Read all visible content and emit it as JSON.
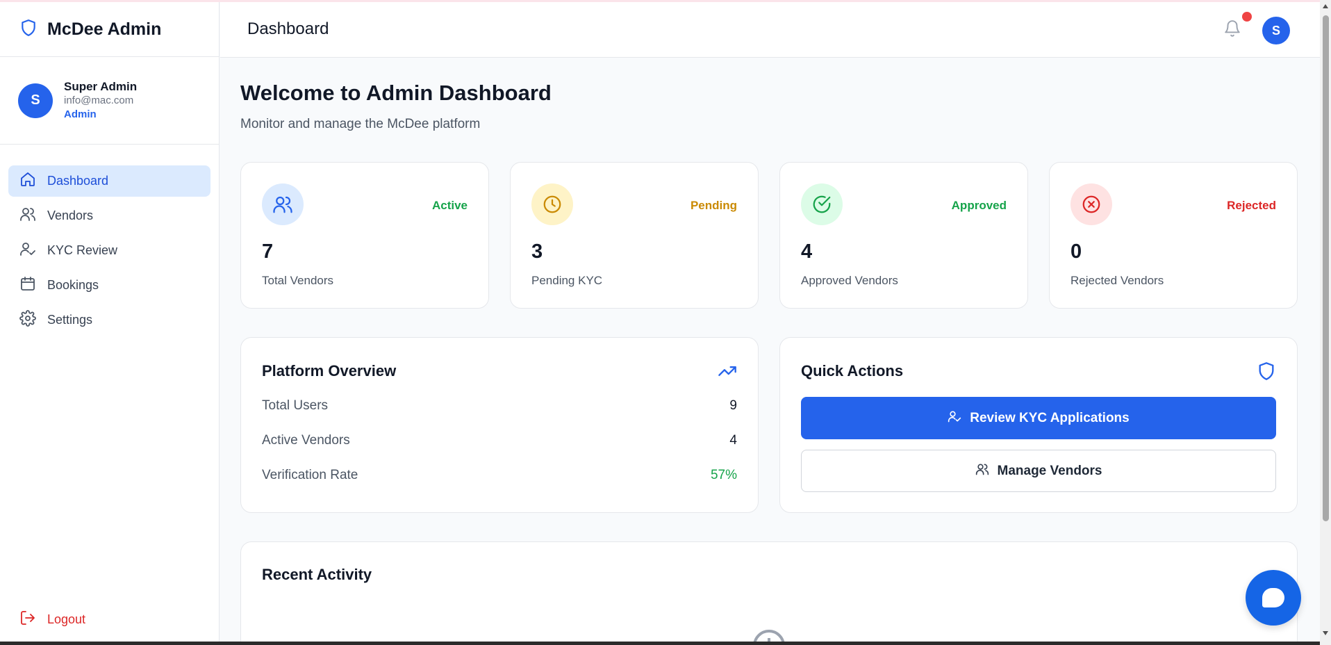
{
  "brand": {
    "name": "McDee Admin"
  },
  "user": {
    "initial": "S",
    "name": "Super Admin",
    "email": "info@mac.com",
    "role": "Admin"
  },
  "nav": {
    "items": [
      {
        "label": "Dashboard",
        "icon": "home-icon",
        "active": true
      },
      {
        "label": "Vendors",
        "icon": "users-icon",
        "active": false
      },
      {
        "label": "KYC Review",
        "icon": "user-check-icon",
        "active": false
      },
      {
        "label": "Bookings",
        "icon": "calendar-icon",
        "active": false
      },
      {
        "label": "Settings",
        "icon": "gear-icon",
        "active": false
      }
    ],
    "logout_label": "Logout"
  },
  "header": {
    "title": "Dashboard",
    "avatar_initial": "S",
    "notification_icon": "bell-icon"
  },
  "welcome": {
    "title": "Welcome to Admin Dashboard",
    "subtitle": "Monitor and manage the McDee platform"
  },
  "stats": [
    {
      "value": "7",
      "label": "Total Vendors",
      "badge": "Active",
      "icon": "users-icon",
      "color": "#16a34a",
      "bg": "#dbeafe",
      "icon_color": "#2563eb"
    },
    {
      "value": "3",
      "label": "Pending KYC",
      "badge": "Pending",
      "icon": "clock-icon",
      "color": "#ca8a04",
      "bg": "#fef3c7",
      "icon_color": "#ca8a04"
    },
    {
      "value": "4",
      "label": "Approved Vendors",
      "badge": "Approved",
      "icon": "check-circle-icon",
      "color": "#16a34a",
      "bg": "#dcfce7",
      "icon_color": "#16a34a"
    },
    {
      "value": "0",
      "label": "Rejected Vendors",
      "badge": "Rejected",
      "icon": "x-circle-icon",
      "color": "#dc2626",
      "bg": "#fee2e2",
      "icon_color": "#dc2626"
    }
  ],
  "overview": {
    "title": "Platform Overview",
    "icon": "trending-up-icon",
    "rows": [
      {
        "label": "Total Users",
        "value": "9"
      },
      {
        "label": "Active Vendors",
        "value": "4"
      },
      {
        "label": "Verification Rate",
        "value": "57%"
      }
    ]
  },
  "quick_actions": {
    "title": "Quick Actions",
    "icon": "shield-icon",
    "primary_label": "Review KYC Applications",
    "secondary_label": "Manage Vendors"
  },
  "recent_activity": {
    "title": "Recent Activity"
  },
  "colors": {
    "accent": "#2563eb",
    "success": "#16a34a",
    "warning": "#ca8a04",
    "danger": "#dc2626"
  }
}
